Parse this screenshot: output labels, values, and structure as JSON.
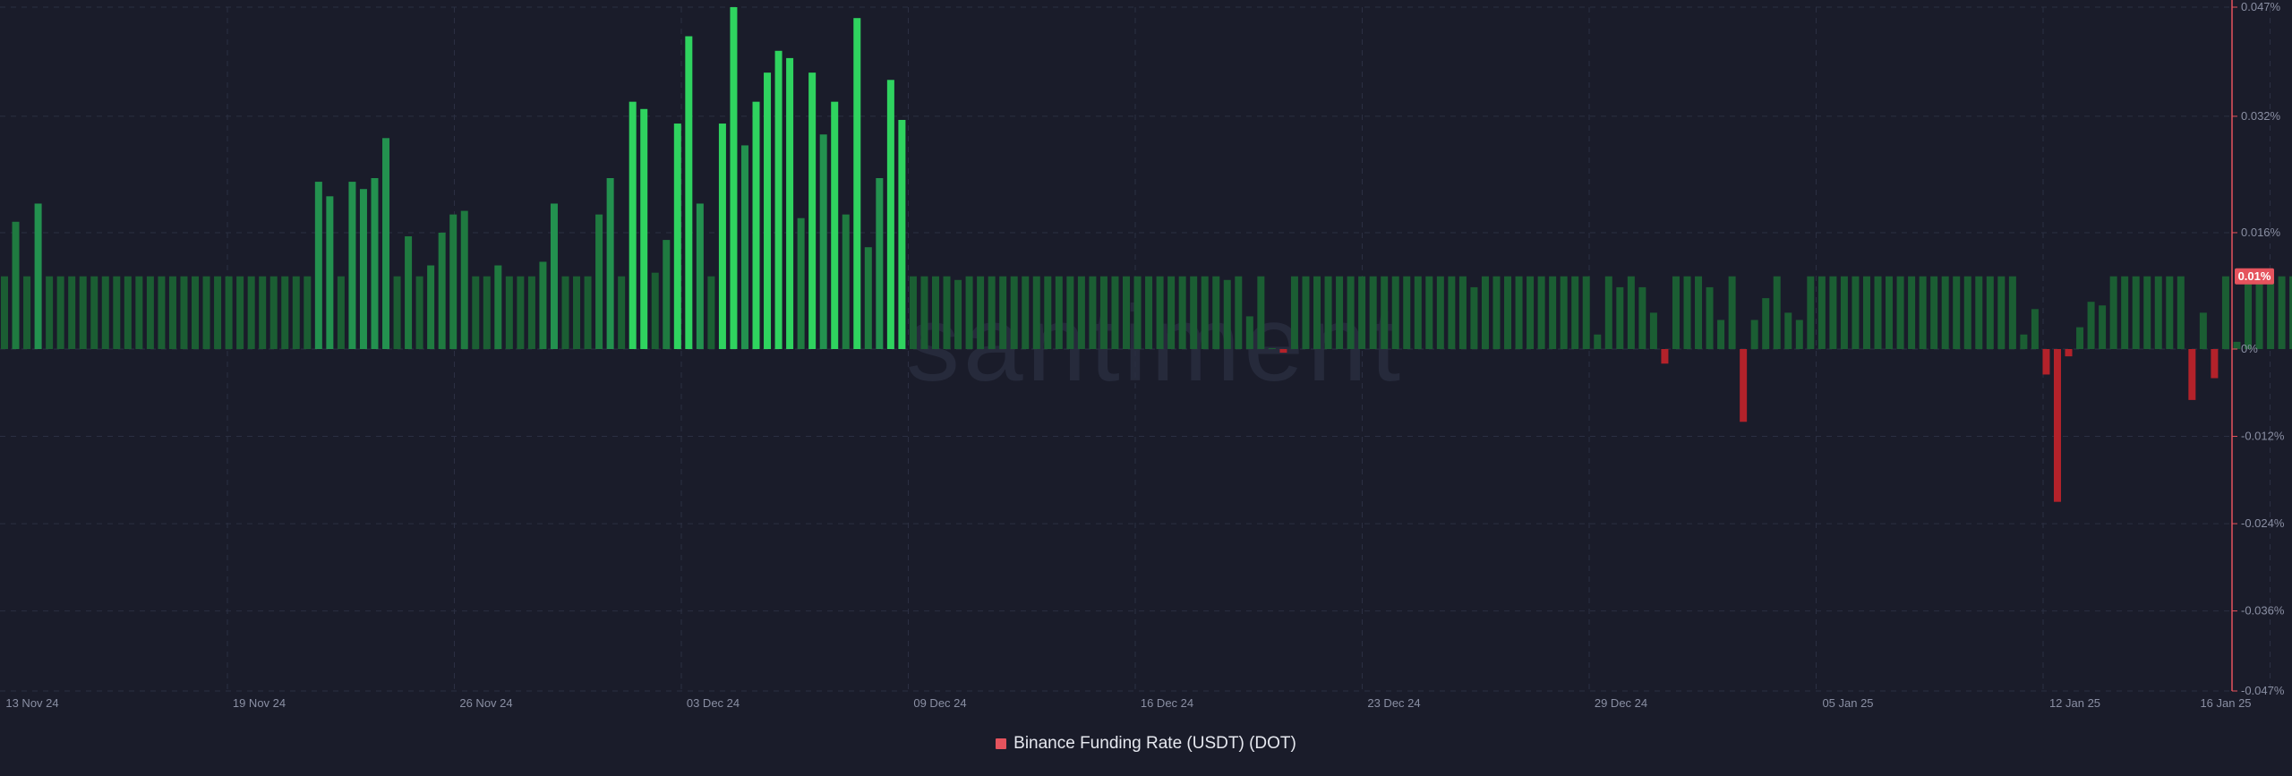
{
  "watermark": "santiment",
  "legend": {
    "label": "Binance Funding Rate (USDT) (DOT)",
    "color": "#e5535d"
  },
  "current_value_badge": "0.01%",
  "colors": {
    "background": "#1a1c2a",
    "grid": "#2b2f42",
    "axis_line": "#e5535d",
    "badge": "#e5535d",
    "positive_base": "#1b5e33",
    "positive_mid": "#23914f",
    "positive_high": "#2fd35f",
    "negative": "#b3222a"
  },
  "chart_data": {
    "type": "bar",
    "series_name": "Binance Funding Rate (USDT) (DOT)",
    "x_tick_labels": [
      "13 Nov 24",
      "19 Nov 24",
      "26 Nov 24",
      "03 Dec 24",
      "09 Dec 24",
      "16 Dec 24",
      "23 Dec 24",
      "29 Dec 24",
      "05 Jan 25",
      "12 Jan 25",
      "16 Jan 25"
    ],
    "y_tick_labels": [
      "0.047%",
      "0.032%",
      "0.016%",
      "0%",
      "-0.012%",
      "-0.024%",
      "-0.036%",
      "-0.047%"
    ],
    "y_ticks": [
      0.047,
      0.032,
      0.016,
      0,
      -0.012,
      -0.024,
      -0.036,
      -0.047
    ],
    "ylim": [
      -0.047,
      0.047
    ],
    "x_range": [
      "13 Nov 24",
      "16 Jan 25"
    ],
    "grid": true,
    "values": [
      0.01,
      0.0175,
      0.01,
      0.02,
      0.01,
      0.01,
      0.01,
      0.01,
      0.01,
      0.01,
      0.01,
      0.01,
      0.01,
      0.01,
      0.01,
      0.01,
      0.01,
      0.01,
      0.01,
      0.01,
      0.01,
      0.01,
      0.01,
      0.01,
      0.01,
      0.01,
      0.01,
      0.01,
      0.023,
      0.021,
      0.01,
      0.023,
      0.022,
      0.0235,
      0.029,
      0.01,
      0.0155,
      0.01,
      0.0115,
      0.016,
      0.0185,
      0.019,
      0.01,
      0.01,
      0.0115,
      0.01,
      0.01,
      0.01,
      0.012,
      0.02,
      0.01,
      0.01,
      0.01,
      0.0185,
      0.0235,
      0.01,
      0.034,
      0.033,
      0.0105,
      0.015,
      0.031,
      0.043,
      0.02,
      0.01,
      0.031,
      0.047,
      0.028,
      0.034,
      0.038,
      0.041,
      0.04,
      0.018,
      0.038,
      0.0295,
      0.034,
      0.0185,
      0.0455,
      0.014,
      0.0235,
      0.037,
      0.0315,
      0.01,
      0.01,
      0.01,
      0.01,
      0.0095,
      0.01,
      0.01,
      0.01,
      0.01,
      0.01,
      0.01,
      0.01,
      0.01,
      0.01,
      0.01,
      0.01,
      0.01,
      0.01,
      0.01,
      0.01,
      0.01,
      0.01,
      0.01,
      0.01,
      0.01,
      0.01,
      0.01,
      0.01,
      0.0095,
      0.01,
      0.0045,
      0.01,
      0.0,
      -0.0005,
      0.01,
      0.01,
      0.01,
      0.01,
      0.01,
      0.01,
      0.01,
      0.01,
      0.01,
      0.01,
      0.01,
      0.01,
      0.01,
      0.01,
      0.01,
      0.01,
      0.0085,
      0.01,
      0.01,
      0.01,
      0.01,
      0.01,
      0.01,
      0.01,
      0.01,
      0.01,
      0.01,
      0.002,
      0.01,
      0.0085,
      0.01,
      0.0085,
      0.005,
      -0.002,
      0.01,
      0.01,
      0.01,
      0.0085,
      0.004,
      0.01,
      -0.01,
      0.004,
      0.007,
      0.01,
      0.005,
      0.004,
      0.01,
      0.01,
      0.01,
      0.01,
      0.01,
      0.01,
      0.01,
      0.01,
      0.01,
      0.01,
      0.01,
      0.01,
      0.01,
      0.01,
      0.01,
      0.01,
      0.01,
      0.01,
      0.01,
      0.002,
      0.0055,
      -0.0035,
      -0.021,
      -0.001,
      0.003,
      0.0065,
      0.006,
      0.01,
      0.01,
      0.01,
      0.01,
      0.01,
      0.01,
      0.01,
      -0.007,
      0.005,
      -0.004,
      0.01,
      0.001,
      0.01,
      0.01,
      0.01,
      0.01,
      0.01
    ]
  }
}
